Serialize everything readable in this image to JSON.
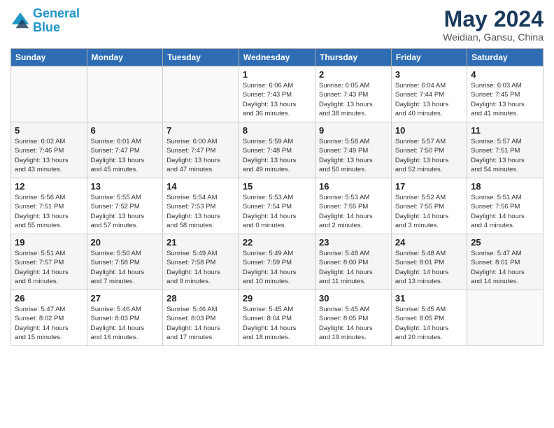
{
  "header": {
    "logo_line1": "General",
    "logo_line2": "Blue",
    "month": "May 2024",
    "location": "Weidian, Gansu, China"
  },
  "days_of_week": [
    "Sunday",
    "Monday",
    "Tuesday",
    "Wednesday",
    "Thursday",
    "Friday",
    "Saturday"
  ],
  "weeks": [
    [
      {
        "day": "",
        "info": ""
      },
      {
        "day": "",
        "info": ""
      },
      {
        "day": "",
        "info": ""
      },
      {
        "day": "1",
        "info": "Sunrise: 6:06 AM\nSunset: 7:43 PM\nDaylight: 13 hours\nand 36 minutes."
      },
      {
        "day": "2",
        "info": "Sunrise: 6:05 AM\nSunset: 7:43 PM\nDaylight: 13 hours\nand 38 minutes."
      },
      {
        "day": "3",
        "info": "Sunrise: 6:04 AM\nSunset: 7:44 PM\nDaylight: 13 hours\nand 40 minutes."
      },
      {
        "day": "4",
        "info": "Sunrise: 6:03 AM\nSunset: 7:45 PM\nDaylight: 13 hours\nand 41 minutes."
      }
    ],
    [
      {
        "day": "5",
        "info": "Sunrise: 6:02 AM\nSunset: 7:46 PM\nDaylight: 13 hours\nand 43 minutes."
      },
      {
        "day": "6",
        "info": "Sunrise: 6:01 AM\nSunset: 7:47 PM\nDaylight: 13 hours\nand 45 minutes."
      },
      {
        "day": "7",
        "info": "Sunrise: 6:00 AM\nSunset: 7:47 PM\nDaylight: 13 hours\nand 47 minutes."
      },
      {
        "day": "8",
        "info": "Sunrise: 5:59 AM\nSunset: 7:48 PM\nDaylight: 13 hours\nand 49 minutes."
      },
      {
        "day": "9",
        "info": "Sunrise: 5:58 AM\nSunset: 7:49 PM\nDaylight: 13 hours\nand 50 minutes."
      },
      {
        "day": "10",
        "info": "Sunrise: 5:57 AM\nSunset: 7:50 PM\nDaylight: 13 hours\nand 52 minutes."
      },
      {
        "day": "11",
        "info": "Sunrise: 5:57 AM\nSunset: 7:51 PM\nDaylight: 13 hours\nand 54 minutes."
      }
    ],
    [
      {
        "day": "12",
        "info": "Sunrise: 5:56 AM\nSunset: 7:51 PM\nDaylight: 13 hours\nand 55 minutes."
      },
      {
        "day": "13",
        "info": "Sunrise: 5:55 AM\nSunset: 7:52 PM\nDaylight: 13 hours\nand 57 minutes."
      },
      {
        "day": "14",
        "info": "Sunrise: 5:54 AM\nSunset: 7:53 PM\nDaylight: 13 hours\nand 58 minutes."
      },
      {
        "day": "15",
        "info": "Sunrise: 5:53 AM\nSunset: 7:54 PM\nDaylight: 14 hours\nand 0 minutes."
      },
      {
        "day": "16",
        "info": "Sunrise: 5:53 AM\nSunset: 7:55 PM\nDaylight: 14 hours\nand 2 minutes."
      },
      {
        "day": "17",
        "info": "Sunrise: 5:52 AM\nSunset: 7:55 PM\nDaylight: 14 hours\nand 3 minutes."
      },
      {
        "day": "18",
        "info": "Sunrise: 5:51 AM\nSunset: 7:56 PM\nDaylight: 14 hours\nand 4 minutes."
      }
    ],
    [
      {
        "day": "19",
        "info": "Sunrise: 5:51 AM\nSunset: 7:57 PM\nDaylight: 14 hours\nand 6 minutes."
      },
      {
        "day": "20",
        "info": "Sunrise: 5:50 AM\nSunset: 7:58 PM\nDaylight: 14 hours\nand 7 minutes."
      },
      {
        "day": "21",
        "info": "Sunrise: 5:49 AM\nSunset: 7:58 PM\nDaylight: 14 hours\nand 9 minutes."
      },
      {
        "day": "22",
        "info": "Sunrise: 5:49 AM\nSunset: 7:59 PM\nDaylight: 14 hours\nand 10 minutes."
      },
      {
        "day": "23",
        "info": "Sunrise: 5:48 AM\nSunset: 8:00 PM\nDaylight: 14 hours\nand 11 minutes."
      },
      {
        "day": "24",
        "info": "Sunrise: 5:48 AM\nSunset: 8:01 PM\nDaylight: 14 hours\nand 13 minutes."
      },
      {
        "day": "25",
        "info": "Sunrise: 5:47 AM\nSunset: 8:01 PM\nDaylight: 14 hours\nand 14 minutes."
      }
    ],
    [
      {
        "day": "26",
        "info": "Sunrise: 5:47 AM\nSunset: 8:02 PM\nDaylight: 14 hours\nand 15 minutes."
      },
      {
        "day": "27",
        "info": "Sunrise: 5:46 AM\nSunset: 8:03 PM\nDaylight: 14 hours\nand 16 minutes."
      },
      {
        "day": "28",
        "info": "Sunrise: 5:46 AM\nSunset: 8:03 PM\nDaylight: 14 hours\nand 17 minutes."
      },
      {
        "day": "29",
        "info": "Sunrise: 5:45 AM\nSunset: 8:04 PM\nDaylight: 14 hours\nand 18 minutes."
      },
      {
        "day": "30",
        "info": "Sunrise: 5:45 AM\nSunset: 8:05 PM\nDaylight: 14 hours\nand 19 minutes."
      },
      {
        "day": "31",
        "info": "Sunrise: 5:45 AM\nSunset: 8:05 PM\nDaylight: 14 hours\nand 20 minutes."
      },
      {
        "day": "",
        "info": ""
      }
    ]
  ]
}
